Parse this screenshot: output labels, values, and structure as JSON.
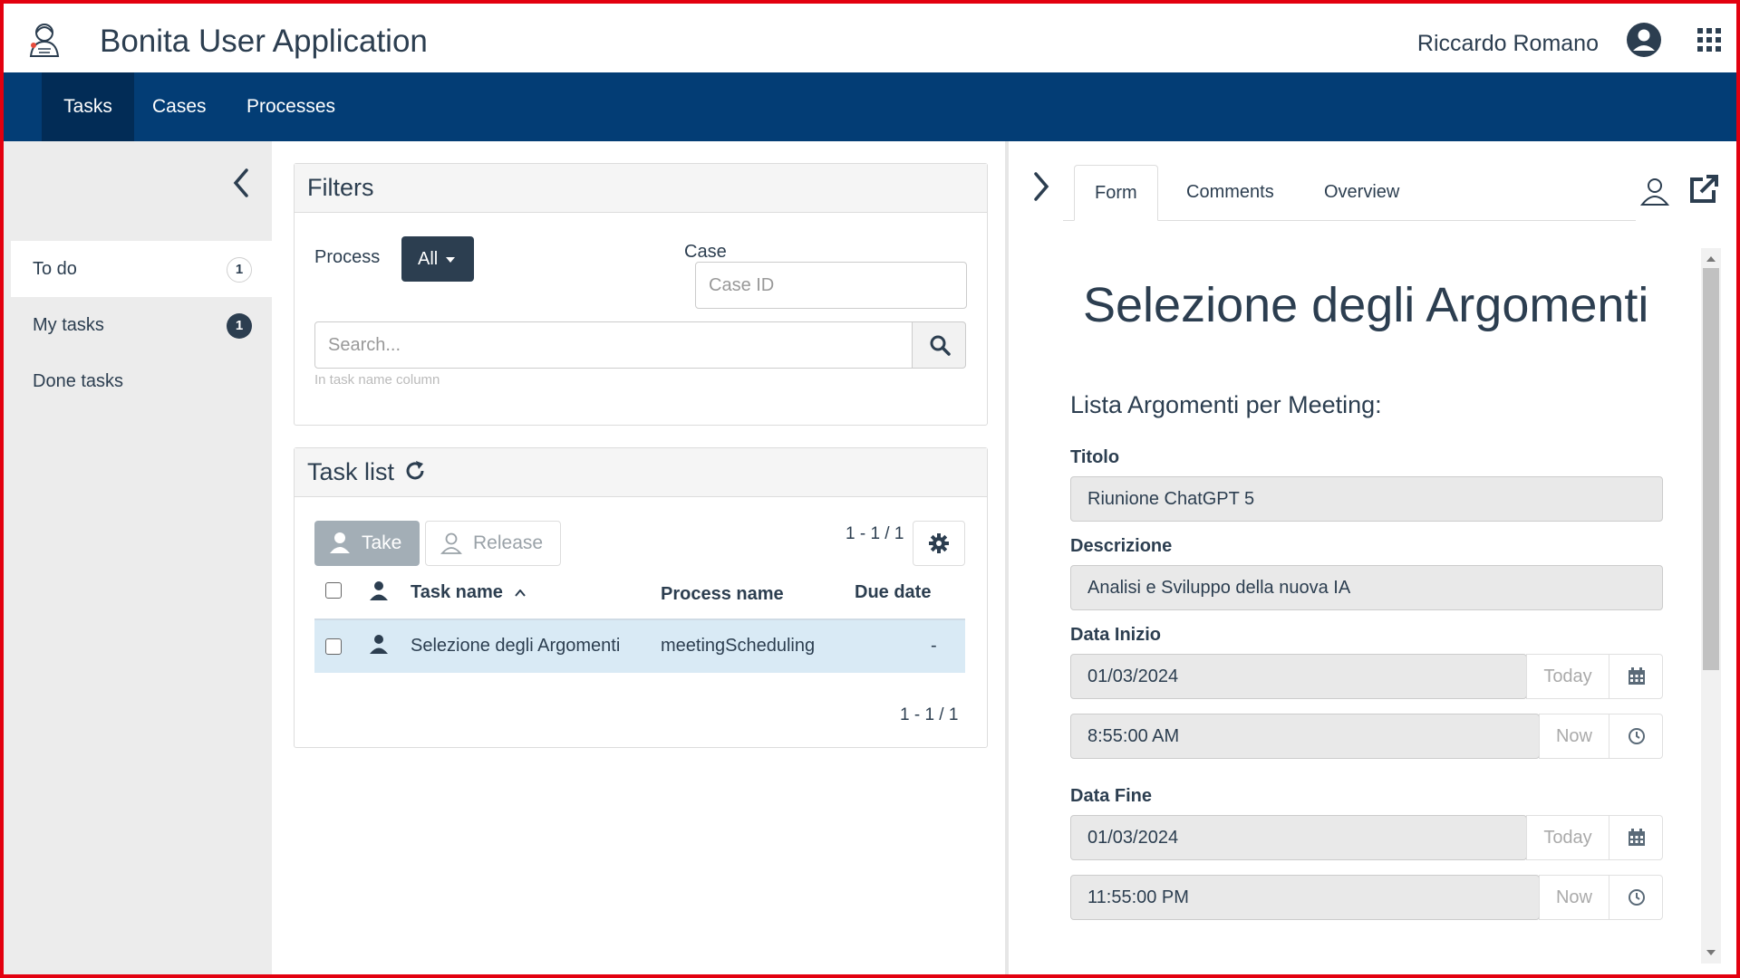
{
  "header": {
    "app_title": "Bonita User Application",
    "user_name": "Riccardo Romano"
  },
  "nav": {
    "items": [
      {
        "label": "Tasks",
        "active": true
      },
      {
        "label": "Cases",
        "active": false
      },
      {
        "label": "Processes",
        "active": false
      }
    ]
  },
  "sidebar": {
    "items": [
      {
        "label": "To do",
        "count": "1",
        "active": true
      },
      {
        "label": "My tasks",
        "count": "1",
        "active": false
      },
      {
        "label": "Done tasks",
        "count": "",
        "active": false
      }
    ]
  },
  "filters": {
    "title": "Filters",
    "process_label": "Process",
    "process_value": "All",
    "case_label": "Case",
    "case_placeholder": "Case ID",
    "search_placeholder": "Search...",
    "search_hint": "In task name column"
  },
  "task_list": {
    "title": "Task list",
    "take_label": "Take",
    "release_label": "Release",
    "pager_top": "1 - 1 / 1",
    "pager_bottom": "1 - 1 / 1",
    "columns": [
      "Task name",
      "Process name",
      "Due date"
    ],
    "rows": [
      {
        "task_name": "Selezione degli Argomenti",
        "process_name": "meetingScheduling",
        "due_date": "-"
      }
    ]
  },
  "detail": {
    "tabs": [
      {
        "label": "Form",
        "active": true
      },
      {
        "label": "Comments",
        "active": false
      },
      {
        "label": "Overview",
        "active": false
      }
    ],
    "form_title": "Selezione degli Argomenti",
    "form_subtitle": "Lista Argomenti per Meeting:",
    "fields": {
      "titolo_label": "Titolo",
      "titolo_value": "Riunione ChatGPT 5",
      "descrizione_label": "Descrizione",
      "descrizione_value": "Analisi e Sviluppo della nuova IA",
      "data_inizio_label": "Data Inizio",
      "data_inizio_date": "01/03/2024",
      "data_inizio_time": "8:55:00 AM",
      "data_fine_label": "Data Fine",
      "data_fine_date": "01/03/2024",
      "data_fine_time": "11:55:00 PM",
      "today_label": "Today",
      "now_label": "Now"
    }
  },
  "colors": {
    "nav_bg": "#033d75",
    "nav_active_bg": "#022c56",
    "primary_dark": "#2c3e50",
    "selected_row": "#d9eaf5",
    "frame_border": "#e3000f"
  }
}
